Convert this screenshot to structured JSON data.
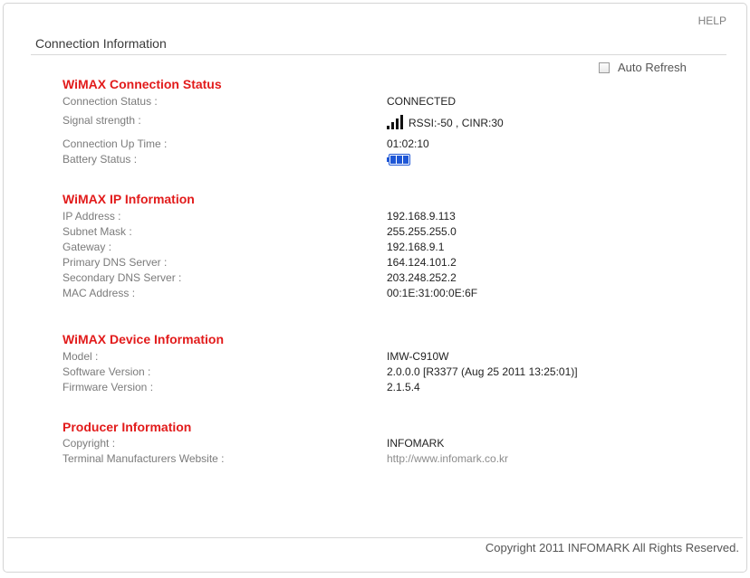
{
  "help_label": "HELP",
  "page_title": "Connection Information",
  "auto_refresh": {
    "label": "Auto Refresh",
    "checked": false
  },
  "connection_status": {
    "heading": "WiMAX Connection Status",
    "status_label": "Connection Status :",
    "status_value": "CONNECTED",
    "signal_label": "Signal strength :",
    "signal_value": "RSSI:-50 , CINR:30",
    "signal_bars": 4,
    "uptime_label": "Connection Up Time :",
    "uptime_value": "01:02:10",
    "battery_label": "Battery Status :",
    "battery_level": 1.0
  },
  "ip_information": {
    "heading": "WiMAX IP Information",
    "rows": [
      {
        "label": "IP Address :",
        "value": "192.168.9.113"
      },
      {
        "label": "Subnet Mask :",
        "value": "255.255.255.0"
      },
      {
        "label": "Gateway :",
        "value": "192.168.9.1"
      },
      {
        "label": "Primary DNS Server :",
        "value": "164.124.101.2"
      },
      {
        "label": "Secondary DNS Server :",
        "value": "203.248.252.2"
      },
      {
        "label": "MAC Address :",
        "value": "00:1E:31:00:0E:6F"
      }
    ]
  },
  "device_information": {
    "heading": "WiMAX Device Information",
    "rows": [
      {
        "label": "Model :",
        "value": "IMW-C910W"
      },
      {
        "label": "Software Version :",
        "value": "2.0.0.0 [R3377 (Aug 25 2011 13:25:01)]"
      },
      {
        "label": "Firmware Version :",
        "value": "2.1.5.4"
      }
    ]
  },
  "producer_information": {
    "heading": "Producer Information",
    "copyright_label": "Copyright :",
    "copyright_value": "INFOMARK",
    "website_label": "Terminal Manufacturers Website :",
    "website_value": "http://www.infomark.co.kr"
  },
  "footer_text": "Copyright 2011 INFOMARK All Rights Reserved.",
  "colors": {
    "section_heading": "#e21b1b",
    "battery": "#1f57d6"
  }
}
